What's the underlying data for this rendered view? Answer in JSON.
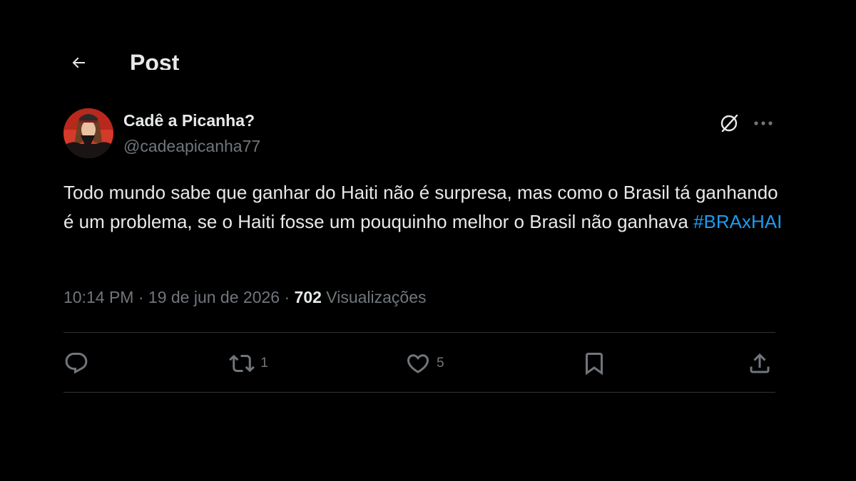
{
  "header": {
    "title": "Post",
    "back_icon": "arrow-left-icon"
  },
  "author": {
    "name": "Cadê a Picanha?",
    "handle": "@cadeapicanha77",
    "avatar_icon": "avatar"
  },
  "tweet": {
    "text_main": "Todo mundo sabe que ganhar do Haiti não é surpresa, mas como o Brasil tá ganhando é um problema, se o Haiti fosse um pouquinho melhor o Brasil não ganhava ",
    "hashtag": "#BRAxHAI",
    "time": "10:14 PM",
    "date": "19 de jun de 2026",
    "separator": "·",
    "views_count": "702",
    "views_label": "Visualizações"
  },
  "actions": {
    "reply_icon": "reply-icon",
    "repost_icon": "repost-icon",
    "repost_count": "1",
    "like_icon": "heart-icon",
    "like_count": "5",
    "bookmark_icon": "bookmark-icon",
    "share_icon": "share-icon"
  },
  "top_icons": {
    "grok": "grok-icon",
    "more": "more-icon"
  },
  "colors": {
    "background": "#000000",
    "text_primary": "#e7e9ea",
    "text_secondary": "#71767b",
    "accent": "#1d9bf0",
    "divider": "#2f3336"
  }
}
